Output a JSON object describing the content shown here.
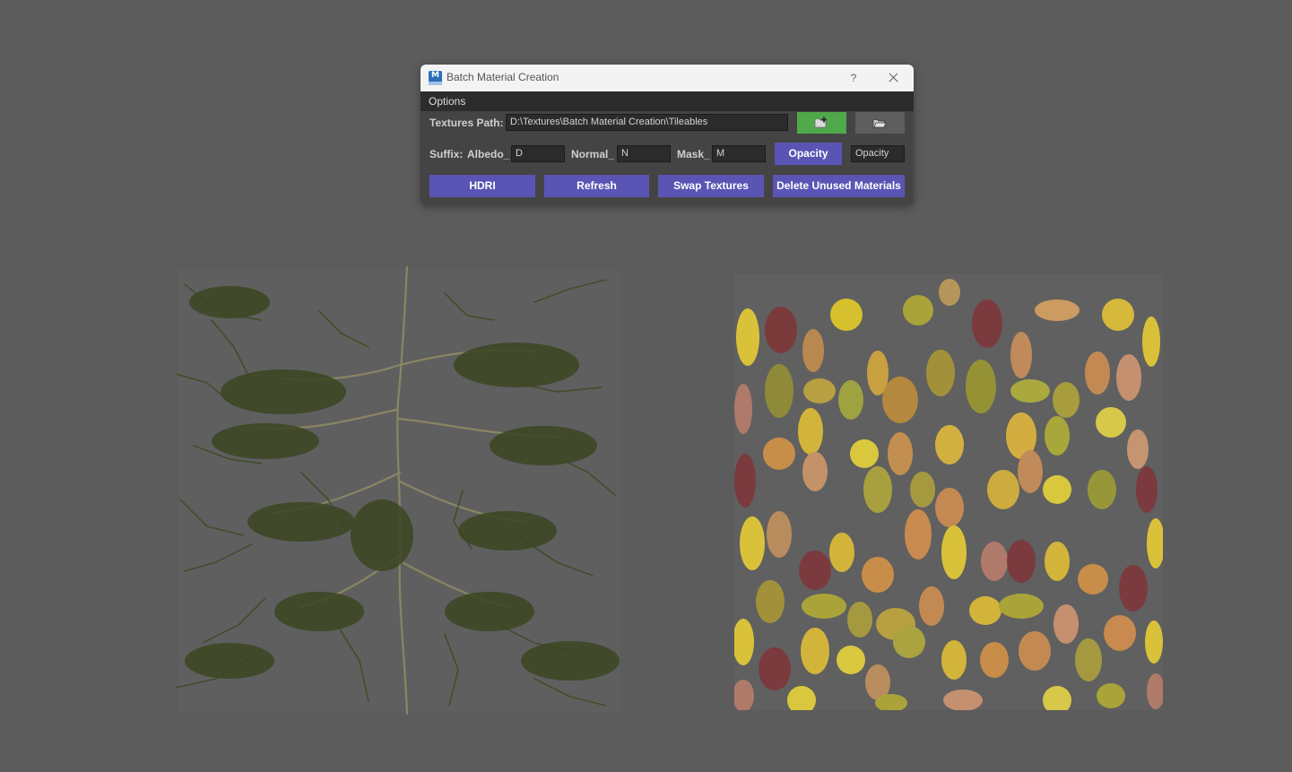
{
  "dialog": {
    "title": "Batch Material Creation",
    "help_label": "?",
    "icon": "maya-app-icon",
    "menu": [
      "Options"
    ],
    "textures_path": {
      "label": "Textures Path:",
      "value": "D:\\Textures\\Batch Material Creation\\Tileables"
    },
    "add_folder_icon": "folder-add-icon",
    "browse_icon": "folder-open-icon",
    "suffix": {
      "label": "Suffix:",
      "albedo_label": "Albedo_",
      "albedo_value": "D",
      "normal_label": "Normal_",
      "normal_value": "N",
      "mask_label": "Mask_",
      "mask_value": "M",
      "opacity_button": "Opacity",
      "opacity_value": "Opacity"
    },
    "buttons": [
      "HDRI",
      "Refresh",
      "Swap Textures",
      "Delete Unused Materials"
    ],
    "colors": {
      "button": "#5a55b4",
      "green_button": "#4fa84a",
      "panel": "#444444",
      "menubar": "#2c2c2c",
      "viewport": "#5c5c5c"
    }
  },
  "viewport": {
    "textures": [
      "conifer-branches-texture",
      "autumn-leaves-texture"
    ]
  }
}
